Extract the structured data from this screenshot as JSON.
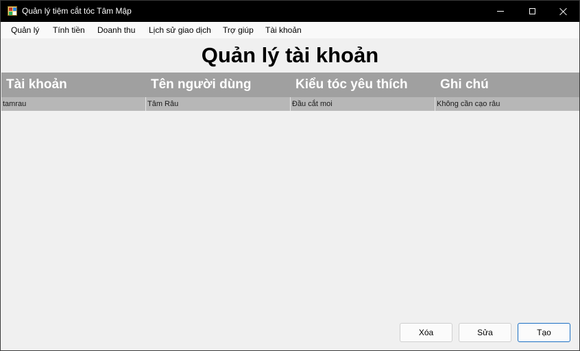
{
  "window": {
    "title": "Quản lý tiệm cắt tóc Tâm Mập"
  },
  "menu": {
    "items": [
      {
        "label": "Quản lý"
      },
      {
        "label": "Tính tiền"
      },
      {
        "label": "Doanh thu"
      },
      {
        "label": "Lịch sử giao dịch"
      },
      {
        "label": "Trợ giúp"
      },
      {
        "label": "Tài khoản"
      }
    ]
  },
  "page": {
    "title": "Quản lý tài khoản"
  },
  "table": {
    "columns": [
      "Tài khoản",
      "Tên người dùng",
      "Kiểu tóc yêu thích",
      "Ghi chú"
    ],
    "rows": [
      [
        "tamrau",
        "Tâm Râu",
        "Đầu cắt moi",
        "Không cần cạo râu"
      ]
    ]
  },
  "actions": {
    "delete_label": "Xóa",
    "edit_label": "Sửa",
    "create_label": "Tạo"
  },
  "colors": {
    "header_bg": "#a0a0a0",
    "row_bg": "#b7b7b7",
    "accent": "#1a6fc4"
  }
}
